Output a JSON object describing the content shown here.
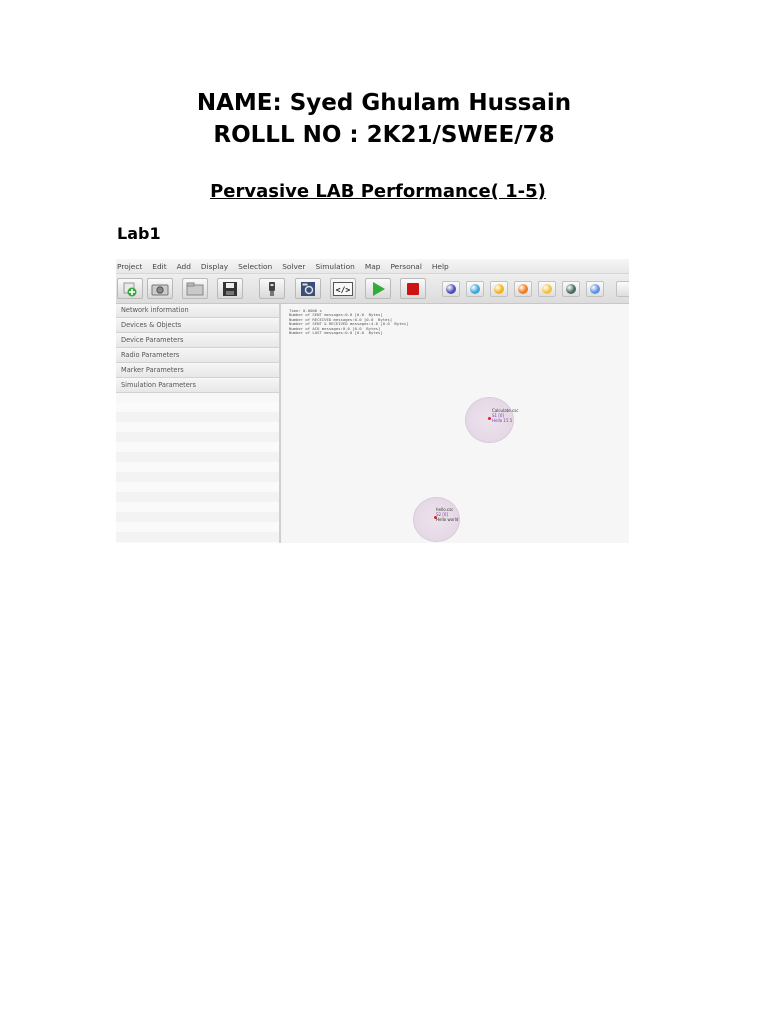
{
  "header": {
    "name_line": "NAME: Syed Ghulam Hussain",
    "roll_line": "ROLLL NO : 2K21/SWEE/78",
    "subtitle": "Pervasive LAB Performance( 1-5)",
    "lab_label": "Lab1"
  },
  "screenshot": {
    "menu": [
      "Project",
      "Edit",
      "Add",
      "Display",
      "Selection",
      "Solver",
      "Simulation",
      "Map",
      "Personal",
      "Help"
    ],
    "toolbar_buttons": [
      {
        "icon": "add-sensor-icon"
      },
      {
        "icon": "camera-icon"
      },
      {
        "icon": "folder-icon"
      },
      {
        "icon": "save-icon"
      },
      {
        "icon": "sensor-device-icon"
      },
      {
        "icon": "gear-code-icon"
      },
      {
        "icon": "code-brackets-icon",
        "label": "</>"
      },
      {
        "icon": "play-icon"
      },
      {
        "icon": "stop-icon"
      }
    ],
    "toolbar_balls": [
      {
        "icon": "sensor-ball-icon",
        "color": "#4b4fb8"
      },
      {
        "icon": "sensor-ball-icon",
        "color": "#3aa7d8"
      },
      {
        "icon": "sensor-ball-icon",
        "color": "#f0b41c"
      },
      {
        "icon": "sensor-ball-icon",
        "color": "#f07a1c"
      },
      {
        "icon": "sun-icon",
        "color": "#f3c23a"
      },
      {
        "icon": "sensor-ball-icon",
        "color": "#4a6a5a"
      },
      {
        "icon": "sparkle-icon",
        "color": "#5b8fe0"
      }
    ],
    "sidebar": [
      "Network information",
      "Devices & Objects",
      "Device Parameters",
      "Radio Parameters",
      "Marker Parameters",
      "Simulation Parameters"
    ],
    "console_lines": [
      "Time: 0.0006 s",
      "Number of SENT messages:0.0 [0.0  Bytes]",
      "Number of RECEIVED messages:0.0 [0.0  Bytes]",
      "Number of SENT & RECEIVED messages:4.0 [0.0  Bytes]",
      "Number of ACK messages:0.0 [0.0  Bytes]",
      "Number of LOST messages:0.0 [0.0  Bytes]"
    ],
    "nodes": [
      {
        "line1": "Calculate.csc",
        "line2": "S1 [0]",
        "line3": "Hello 15.5"
      },
      {
        "line1": "hello.csc",
        "line2": "S2 [0]",
        "line3": "Hello world"
      }
    ]
  }
}
